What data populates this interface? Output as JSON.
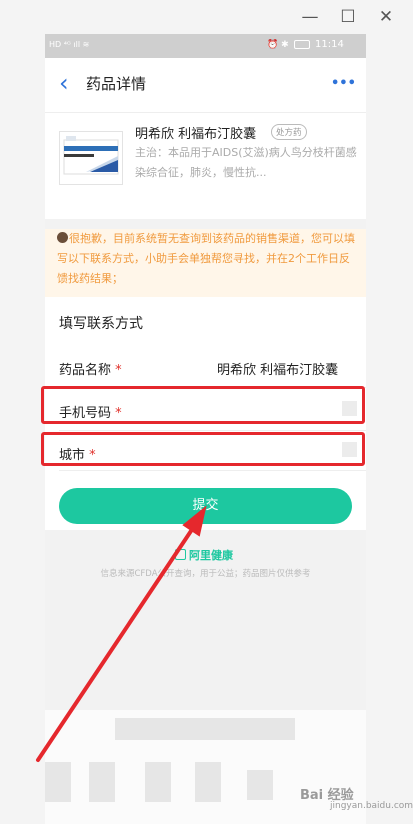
{
  "window": {
    "minimize_icon": "minimize-icon",
    "maximize_icon": "maximize-icon",
    "close_icon": "close-icon"
  },
  "status_bar": {
    "time": "11:14"
  },
  "nav": {
    "back_icon": "back-arrow-icon",
    "title": "药品详情",
    "more_icon": "more-dots-icon"
  },
  "drug": {
    "name": "明希欣 利福布汀胶囊",
    "rx_badge": "处方药",
    "description": "主治：本品用于AIDS(艾滋)病人鸟分枝杆菌感染综合征，肺炎，慢性抗..."
  },
  "notice": {
    "text": "很抱歉，目前系统暂无查询到该药品的销售渠道，您可以填写以下联系方式，小助手会单独帮您寻找，并在2个工作日反馈找药结果；"
  },
  "form": {
    "title": "填写联系方式",
    "drug_label": "药品名称",
    "drug_value": "明希欣 利福布汀胶囊",
    "phone_label": "手机号码",
    "city_label": "城市",
    "required_mark": "*",
    "submit_label": "提交"
  },
  "footer": {
    "brand": "阿里健康",
    "note": "信息来源CFDA公开查询，用于公益；药品图片仅供参考"
  },
  "annotations": {
    "highlight_color": "#e5282d",
    "arrow_color": "#e5282d",
    "accent_color": "#1dc8a0"
  },
  "watermark": {
    "text": "Bai 经验",
    "url": "jingyan.baidu.com"
  }
}
